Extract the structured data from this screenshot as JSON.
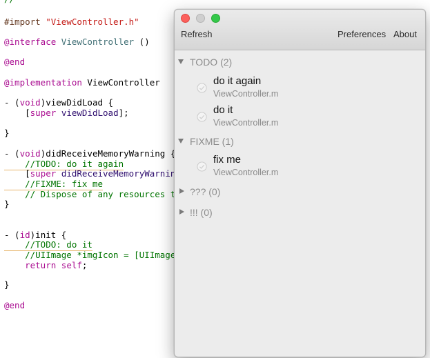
{
  "editor": {
    "lines": [
      {
        "tokens": [
          {
            "c": "tok-comment",
            "t": "//"
          }
        ]
      },
      {
        "tokens": [
          {
            "c": "tok-directive",
            "t": "#import "
          },
          {
            "c": "tok-string",
            "t": "\"ViewController.h\""
          }
        ]
      },
      {
        "tokens": [
          {
            "c": "tok-keyword",
            "t": "@interface "
          },
          {
            "c": "tok-type",
            "t": "ViewController"
          },
          {
            "c": "tok-plain",
            "t": " ()"
          }
        ]
      },
      {
        "tokens": [
          {
            "c": "tok-keyword",
            "t": "@end"
          }
        ]
      },
      {
        "tokens": [
          {
            "c": "tok-keyword",
            "t": "@implementation "
          },
          {
            "c": "tok-plain",
            "t": "ViewController"
          }
        ]
      },
      {
        "tokens": [
          {
            "c": "tok-plain",
            "t": "- ("
          },
          {
            "c": "tok-keyword",
            "t": "void"
          },
          {
            "c": "tok-plain",
            "t": ")viewDidLoad {"
          }
        ]
      },
      {
        "tokens": [
          {
            "c": "tok-plain",
            "t": "    ["
          },
          {
            "c": "tok-keyword",
            "t": "super"
          },
          {
            "c": "tok-plain",
            "t": " "
          },
          {
            "c": "tok-method",
            "t": "viewDidLoad"
          },
          {
            "c": "tok-plain",
            "t": "];"
          }
        ]
      },
      {
        "tokens": [
          {
            "c": "tok-plain",
            "t": "}"
          }
        ]
      },
      {
        "tokens": [
          {
            "c": "tok-plain",
            "t": "- ("
          },
          {
            "c": "tok-keyword",
            "t": "void"
          },
          {
            "c": "tok-plain",
            "t": ")didReceiveMemoryWarning {"
          }
        ]
      },
      {
        "tokens": [
          {
            "c": "tok-comment underline-todo",
            "t": "    //TODO: do it again"
          }
        ]
      },
      {
        "tokens": [
          {
            "c": "tok-plain",
            "t": "    ["
          },
          {
            "c": "tok-keyword",
            "t": "super"
          },
          {
            "c": "tok-plain",
            "t": " "
          },
          {
            "c": "tok-method",
            "t": "didReceiveMemoryWarning"
          }
        ]
      },
      {
        "tokens": [
          {
            "c": "tok-comment underline-todo",
            "t": "    //FIXME: fix me"
          }
        ]
      },
      {
        "tokens": [
          {
            "c": "tok-comment",
            "t": "    // Dispose of any resources t"
          }
        ]
      },
      {
        "tokens": [
          {
            "c": "tok-plain",
            "t": "}"
          }
        ]
      },
      {
        "tokens": [
          {
            "c": "tok-plain",
            "t": "- ("
          },
          {
            "c": "tok-keyword",
            "t": "id"
          },
          {
            "c": "tok-plain",
            "t": ")init {"
          }
        ]
      },
      {
        "tokens": [
          {
            "c": "tok-comment underline-todo",
            "t": "    //TODO: do it"
          }
        ]
      },
      {
        "tokens": [
          {
            "c": "tok-comment",
            "t": "    //UIImage *imgIcon = [UIImage"
          }
        ]
      },
      {
        "tokens": [
          {
            "c": "tok-plain",
            "t": "    "
          },
          {
            "c": "tok-keyword",
            "t": "return"
          },
          {
            "c": "tok-plain",
            "t": " "
          },
          {
            "c": "tok-keyword",
            "t": "self"
          },
          {
            "c": "tok-plain",
            "t": ";"
          }
        ]
      },
      {
        "tokens": [
          {
            "c": "tok-plain",
            "t": "}"
          }
        ]
      },
      {
        "tokens": [
          {
            "c": "tok-keyword",
            "t": "@end"
          }
        ]
      }
    ]
  },
  "window": {
    "traffic_lights": [
      "close-icon",
      "minimize-icon",
      "zoom-icon"
    ],
    "toolbar": {
      "refresh_label": "Refresh",
      "preferences_label": "Preferences",
      "about_label": "About"
    },
    "groups": [
      {
        "label": "TODO (2)",
        "expanded": true,
        "items": [
          {
            "title": "do it again",
            "file": "ViewController.m"
          },
          {
            "title": "do it",
            "file": "ViewController.m"
          }
        ]
      },
      {
        "label": "FIXME (1)",
        "expanded": true,
        "items": [
          {
            "title": "fix me",
            "file": "ViewController.m"
          }
        ]
      },
      {
        "label": "??? (0)",
        "expanded": false,
        "items": []
      },
      {
        "label": "!!! (0)",
        "expanded": false,
        "items": []
      }
    ]
  },
  "colors": {
    "close": "#fc605c",
    "minimize": "#cfcfcf",
    "zoom": "#34c84a",
    "group_label": "#8c8c8c",
    "item_sub": "#8a8a8a"
  }
}
